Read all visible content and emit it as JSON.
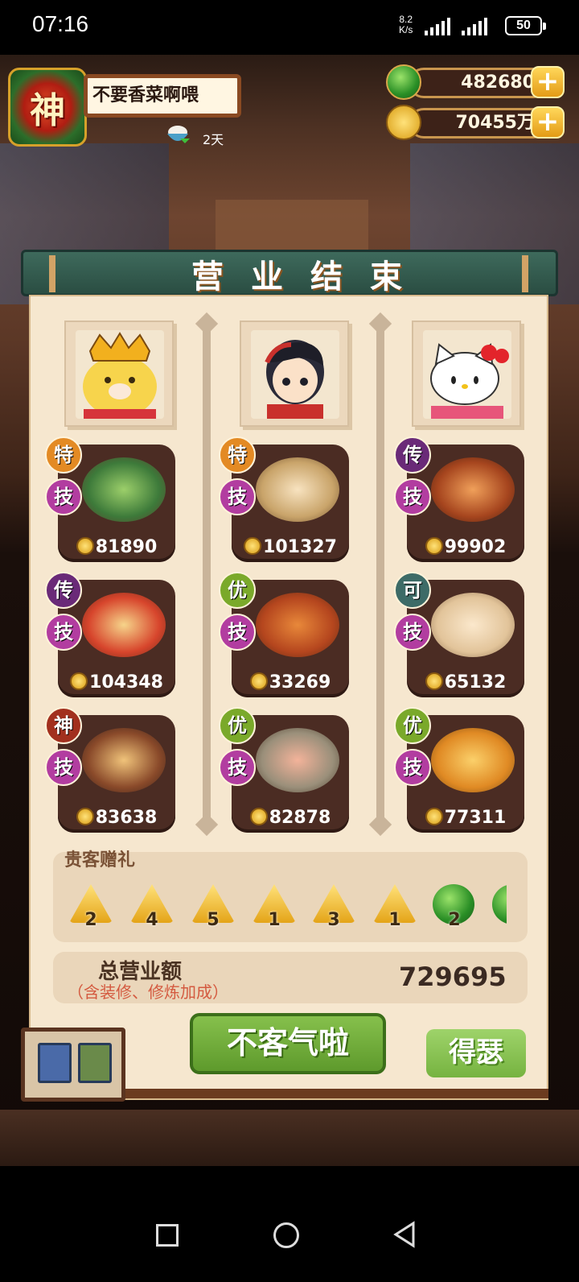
{
  "status": {
    "time": "07:16",
    "net_speed": "8.2",
    "net_unit": "K/s",
    "battery": "50"
  },
  "player": {
    "avatar_char": "神",
    "name": "不要香菜啊喂",
    "days": "2天"
  },
  "currency": {
    "jade": "482680",
    "coins": "70455万",
    "plus": "+"
  },
  "title_chars": [
    "营",
    "业",
    "结",
    "束"
  ],
  "columns": [
    {
      "guest": "crown-bird",
      "dishes": [
        {
          "grade": "特",
          "grade_color": "#e38a24",
          "skill": "技",
          "price": "81890"
        },
        {
          "grade": "传",
          "grade_color": "#6a2a78",
          "skill": "技",
          "price": "104348"
        },
        {
          "grade": "神",
          "grade_color": "#a2301e",
          "skill": "技",
          "price": "83638"
        }
      ]
    },
    {
      "guest": "boy-chef",
      "dishes": [
        {
          "grade": "特",
          "grade_color": "#e38a24",
          "skill": "技",
          "price": "101327"
        },
        {
          "grade": "优",
          "grade_color": "#7aa92a",
          "skill": "技",
          "price": "33269"
        },
        {
          "grade": "优",
          "grade_color": "#7aa92a",
          "skill": "技",
          "price": "82878"
        }
      ]
    },
    {
      "guest": "hello-kitty",
      "dishes": [
        {
          "grade": "传",
          "grade_color": "#6a2a78",
          "skill": "技",
          "price": "99902"
        },
        {
          "grade": "可",
          "grade_color": "#3d6b67",
          "skill": "技",
          "price": "65132"
        },
        {
          "grade": "优",
          "grade_color": "#7aa92a",
          "skill": "技",
          "price": "77311"
        }
      ]
    }
  ],
  "gifts": {
    "title": "贵客赠礼",
    "items": [
      {
        "type": "zongzi",
        "count": "2"
      },
      {
        "type": "zongzi",
        "count": "4"
      },
      {
        "type": "zongzi",
        "count": "5"
      },
      {
        "type": "zongzi",
        "count": "1"
      },
      {
        "type": "zongzi",
        "count": "3"
      },
      {
        "type": "zongzi",
        "count": "1"
      },
      {
        "type": "jade",
        "count": "2"
      }
    ]
  },
  "total": {
    "label": "总营业额",
    "sub": "（含装修、修炼加成）",
    "value": "729695"
  },
  "buttons": {
    "main": "不客气啦",
    "side": "得瑟"
  }
}
